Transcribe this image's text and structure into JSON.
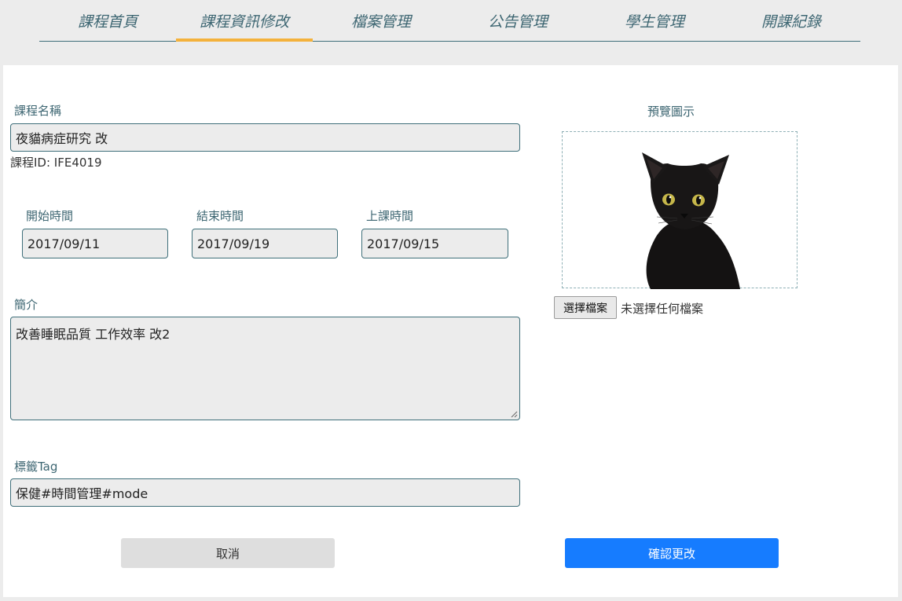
{
  "nav": {
    "tabs": [
      {
        "label": "課程首頁"
      },
      {
        "label": "課程資訊修改"
      },
      {
        "label": "檔案管理"
      },
      {
        "label": "公告管理"
      },
      {
        "label": "學生管理"
      },
      {
        "label": "開課紀錄"
      }
    ],
    "active_index": 1,
    "active_color": "#f4b23c"
  },
  "form": {
    "course_name_label": "課程名稱",
    "course_name_value": "夜貓病症研究 改",
    "course_id_text": "課程ID: IFE4019",
    "start_label": "開始時間",
    "start_value": "2017/09/11",
    "end_label": "結束時間",
    "end_value": "2017/09/19",
    "class_label": "上課時間",
    "class_value": "2017/09/15",
    "intro_label": "簡介",
    "intro_value": "改善睡眠品質 工作效率 改2",
    "tag_label": "標籤Tag",
    "tag_value": "保健#時間管理#mode"
  },
  "preview": {
    "label": "預覽圖示",
    "image_subject": "black-cat",
    "file_button_label": "選擇檔案",
    "file_status": "未選擇任何檔案"
  },
  "actions": {
    "cancel_label": "取消",
    "confirm_label": "確認更改",
    "confirm_color": "#167cff"
  }
}
